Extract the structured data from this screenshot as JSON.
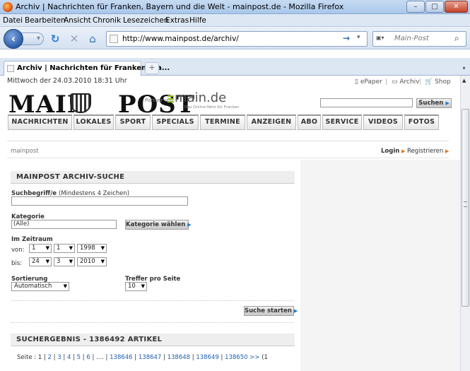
{
  "window": {
    "title": "Archiv | Nachrichten für Franken, Bayern und die Welt - mainpost.de - Mozilla Firefox",
    "minimize": "–",
    "maximize": "□",
    "close": "✕"
  },
  "menubar": [
    "Datei",
    "Bearbeiten",
    "Ansicht",
    "Chronik",
    "Lesezeichen",
    "Extras",
    "Hilfe"
  ],
  "toolbar": {
    "url": "http://www.mainpost.de/archiv/",
    "search_placeholder": "Main-Post",
    "search_engine_icon": "mainpost-icon"
  },
  "tab": {
    "label": "Archiv | Nachrichten für Franken, Ba...",
    "new_tab": "+"
  },
  "site": {
    "date": "Mittwoch der 24.03.2010 18:31 Uhr",
    "epaper": "ePaper",
    "archiv": "Archiv",
    "shop": "Shop",
    "logo_left": "MAIN",
    "logo_right": "POST",
    "partner_prefix": "Partner von",
    "partner_name": "main.de",
    "partner_sub": "Das Online-Netz für Franken",
    "search_button": "Suchen",
    "nav": [
      "NACHRICHTEN",
      "LOKALES",
      "SPORT",
      "SPECIALS",
      "TERMINE",
      "ANZEIGEN",
      "ABO",
      "SERVICE",
      "VIDEOS",
      "FOTOS"
    ],
    "breadcrumb": "mainpost",
    "login": "Login",
    "register": "Registrieren"
  },
  "archive": {
    "heading": "MAINPOST ARCHIV-SUCHE",
    "term_label": "Suchbegriff/e",
    "term_hint": "(Mindestens 4 Zeichen)",
    "term_value": "",
    "category_label": "Kategorie",
    "category_value": "(Alle)",
    "category_button": "Kategorie wählen",
    "period_label": "Im Zeitraum",
    "from_label": "von:",
    "to_label": "bis:",
    "from": {
      "day": "1",
      "month": "1",
      "year": "1998"
    },
    "to": {
      "day": "24",
      "month": "3",
      "year": "2010"
    },
    "sort_label": "Sortierung",
    "sort_value": "Automatisch",
    "per_page_label": "Treffer pro Seite",
    "per_page_value": "10",
    "submit_button": "Suche starten"
  },
  "results": {
    "heading": "SUCHERGEBNIS - 1386492 ARTIKEL",
    "pager_prefix": "Seite :",
    "current_page": "1",
    "pages": [
      "2",
      "3",
      "4",
      "5",
      "6"
    ],
    "ellipsis": "....",
    "late_pages": [
      "138646",
      "138647",
      "138648",
      "138649",
      "138650"
    ],
    "next": ">>",
    "tail": "(1"
  }
}
